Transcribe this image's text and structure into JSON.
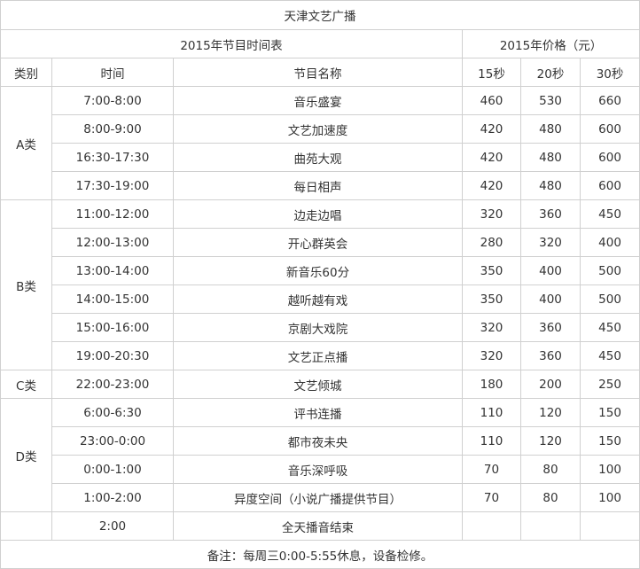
{
  "title": "天津文艺广播",
  "schedule_header": "2015年节目时间表",
  "price_header": "2015年价格（元）",
  "columns": {
    "category": "类别",
    "time": "时间",
    "program": "节目名称",
    "p15": "15秒",
    "p20": "20秒",
    "p30": "30秒"
  },
  "groups": [
    {
      "category": "A类",
      "rows": [
        {
          "time": "7:00-8:00",
          "program": "音乐盛宴",
          "p15": "460",
          "p20": "530",
          "p30": "660"
        },
        {
          "time": "8:00-9:00",
          "program": "文艺加速度",
          "p15": "420",
          "p20": "480",
          "p30": "600"
        },
        {
          "time": "16:30-17:30",
          "program": "曲苑大观",
          "p15": "420",
          "p20": "480",
          "p30": "600"
        },
        {
          "time": "17:30-19:00",
          "program": "每日相声",
          "p15": "420",
          "p20": "480",
          "p30": "600"
        }
      ]
    },
    {
      "category": "B类",
      "rows": [
        {
          "time": "11:00-12:00",
          "program": "边走边唱",
          "p15": "320",
          "p20": "360",
          "p30": "450"
        },
        {
          "time": "12:00-13:00",
          "program": "开心群英会",
          "p15": "280",
          "p20": "320",
          "p30": "400"
        },
        {
          "time": "13:00-14:00",
          "program": "新音乐60分",
          "p15": "350",
          "p20": "400",
          "p30": "500"
        },
        {
          "time": "14:00-15:00",
          "program": "越听越有戏",
          "p15": "350",
          "p20": "400",
          "p30": "500"
        },
        {
          "time": "15:00-16:00",
          "program": "京剧大戏院",
          "p15": "320",
          "p20": "360",
          "p30": "450"
        },
        {
          "time": "19:00-20:30",
          "program": "文艺正点播",
          "p15": "320",
          "p20": "360",
          "p30": "450"
        }
      ]
    },
    {
      "category": "C类",
      "rows": [
        {
          "time": "22:00-23:00",
          "program": "文艺倾城",
          "p15": "180",
          "p20": "200",
          "p30": "250"
        }
      ]
    },
    {
      "category": "D类",
      "rows": [
        {
          "time": "6:00-6:30",
          "program": "评书连播",
          "p15": "110",
          "p20": "120",
          "p30": "150"
        },
        {
          "time": "23:00-0:00",
          "program": "都市夜未央",
          "p15": "110",
          "p20": "120",
          "p30": "150"
        },
        {
          "time": "0:00-1:00",
          "program": "音乐深呼吸",
          "p15": "70",
          "p20": "80",
          "p30": "100"
        },
        {
          "time": "1:00-2:00",
          "program": "异度空间（小说广播提供节目）",
          "p15": "70",
          "p20": "80",
          "p30": "100"
        }
      ]
    }
  ],
  "end_row": {
    "time": "2:00",
    "program": "全天播音结束"
  },
  "note": "备注：每周三0:00-5:55休息，设备检修。"
}
